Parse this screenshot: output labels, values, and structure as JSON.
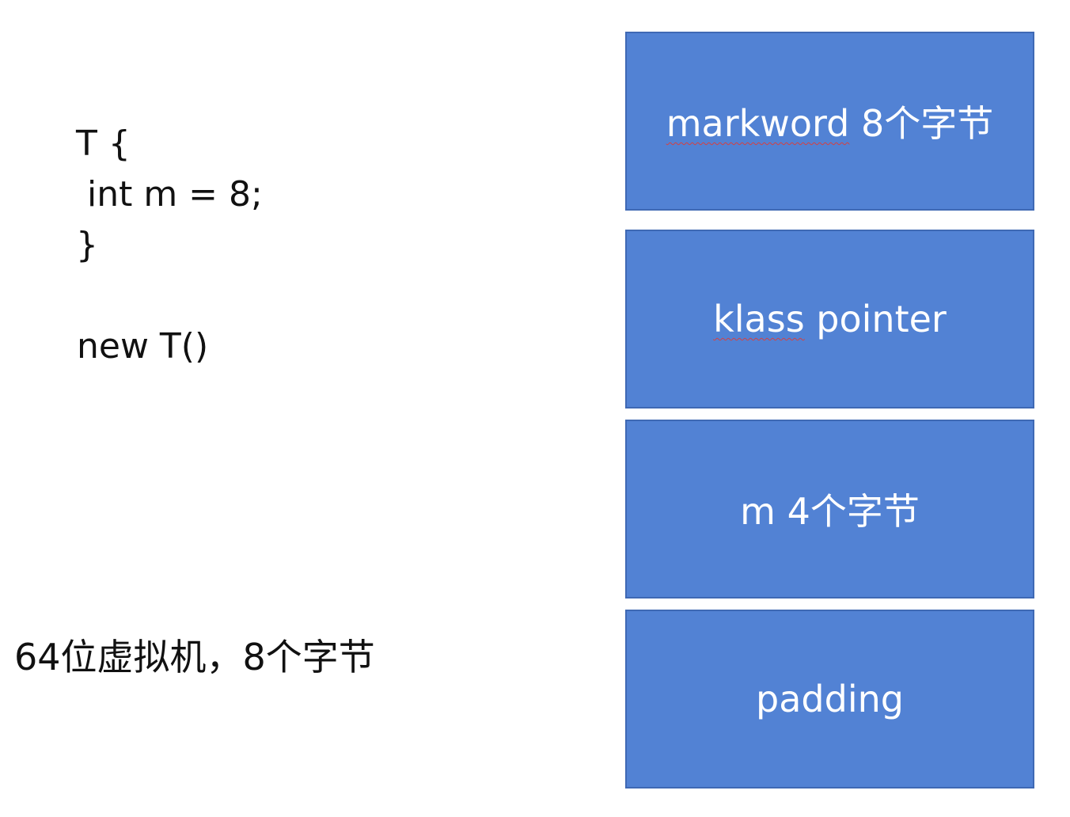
{
  "code": {
    "lines": [
      "T {",
      " int m = 8;",
      "}"
    ],
    "instantiation": "new T()"
  },
  "note": "64位虚拟机，8个字节",
  "layout_blocks": [
    {
      "label_word": "markword",
      "label_rest": " 8个字节"
    },
    {
      "label_word": "klass",
      "label_rest": " pointer"
    },
    {
      "label_word": "",
      "label_rest": "m 4个字节"
    },
    {
      "label_word": "",
      "label_rest": "padding"
    }
  ],
  "colors": {
    "block_fill": "#5282d4",
    "block_border": "#3f69b4",
    "block_text": "#ffffff",
    "spellcheck_underline": "#d64040"
  }
}
